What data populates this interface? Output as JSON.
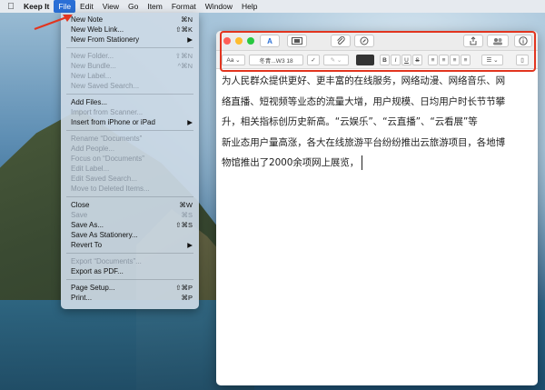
{
  "menubar": {
    "apple_icon": "apple-logo-icon",
    "app_name": "Keep It",
    "items": [
      "File",
      "Edit",
      "View",
      "Go",
      "Item",
      "Format",
      "Window",
      "Help"
    ]
  },
  "file_menu": {
    "groups": [
      [
        {
          "label": "New Note",
          "shortcut": "⌘N",
          "enabled": true
        },
        {
          "label": "New Web Link...",
          "shortcut": "⇧⌘K",
          "enabled": true
        },
        {
          "label": "New From Stationery",
          "shortcut": "▶",
          "enabled": true
        }
      ],
      [
        {
          "label": "New Folder...",
          "shortcut": "⇧⌘N",
          "enabled": false
        },
        {
          "label": "New Bundle...",
          "shortcut": "^⌘N",
          "enabled": false
        },
        {
          "label": "New Label...",
          "shortcut": "",
          "enabled": false
        },
        {
          "label": "New Saved Search...",
          "shortcut": "",
          "enabled": false
        }
      ],
      [
        {
          "label": "Add Files...",
          "shortcut": "",
          "enabled": true
        },
        {
          "label": "Import from Scanner...",
          "shortcut": "",
          "enabled": false
        },
        {
          "label": "Insert from iPhone or iPad",
          "shortcut": "▶",
          "enabled": true
        }
      ],
      [
        {
          "label": "Rename “Documents”",
          "shortcut": "",
          "enabled": false
        },
        {
          "label": "Add People...",
          "shortcut": "",
          "enabled": false
        },
        {
          "label": "Focus on “Documents”",
          "shortcut": "",
          "enabled": false
        },
        {
          "label": "Edit Label...",
          "shortcut": "",
          "enabled": false
        },
        {
          "label": "Edit Saved Search...",
          "shortcut": "",
          "enabled": false
        },
        {
          "label": "Move to Deleted Items...",
          "shortcut": "",
          "enabled": false
        }
      ],
      [
        {
          "label": "Close",
          "shortcut": "⌘W",
          "enabled": true
        },
        {
          "label": "Save",
          "shortcut": "⌘S",
          "enabled": false
        },
        {
          "label": "Save As...",
          "shortcut": "⇧⌘S",
          "enabled": true
        },
        {
          "label": "Save As Stationery...",
          "shortcut": "",
          "enabled": true
        },
        {
          "label": "Revert To",
          "shortcut": "▶",
          "enabled": true
        }
      ],
      [
        {
          "label": "Export “Documents”...",
          "shortcut": "",
          "enabled": false
        },
        {
          "label": "Export as PDF...",
          "shortcut": "",
          "enabled": true
        }
      ],
      [
        {
          "label": "Page Setup...",
          "shortcut": "⇧⌘P",
          "enabled": true
        },
        {
          "label": "Print...",
          "shortcut": "⌘P",
          "enabled": true
        }
      ]
    ]
  },
  "editor": {
    "toolbar": {
      "style_button": "A",
      "font_size_select": "Aa",
      "font_name_select": "冬青...W3  18",
      "check_button": "✓",
      "bold": "B",
      "italic": "I",
      "underline": "U",
      "strike": "S"
    },
    "content_lines": [
      "为人民群众提供更好、更丰富的在线服务，网络动漫、网络音乐、网",
      "络直播、短视频等业态的流量大增，用户规模、日均用户时长节节攀",
      "升，相关指标创历史新高。“云娱乐”、“云直播”、“云看展”等",
      "新业态用户量高涨，各大在线旅游平台纷纷推出云旅游项目，各地博",
      "物馆推出了2000余项网上展览，"
    ]
  },
  "colors": {
    "menu_highlight": "#2a6fd6",
    "annotation_red": "#e2351f",
    "close_light": "#ff5f57",
    "minimize_light": "#febc2e",
    "zoom_light": "#28c840"
  }
}
